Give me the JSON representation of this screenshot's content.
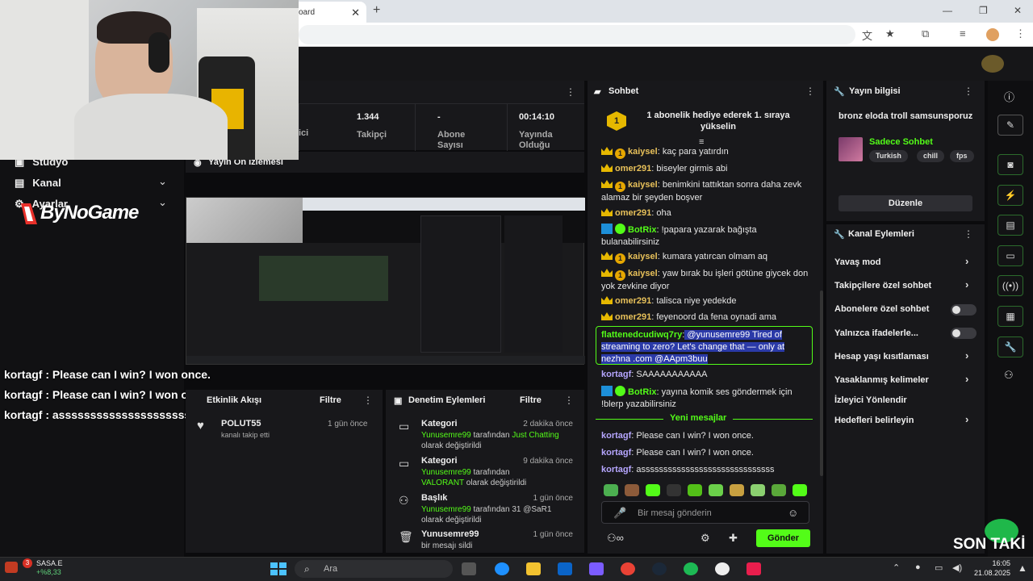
{
  "browser": {
    "tab_label": "oard",
    "tab_close": "✕",
    "new_tab": "+"
  },
  "stats": [
    {
      "value": "",
      "label": "ici"
    },
    {
      "value": "1.344",
      "label": "Takipçi"
    },
    {
      "value": "-",
      "label": "Abone Sayısı"
    },
    {
      "value": "00:14:10",
      "label": "Yayında Olduğu"
    }
  ],
  "left_nav": {
    "items": [
      {
        "label": "Stüdyo"
      },
      {
        "label": "Kanal"
      },
      {
        "label": "Ayarlar"
      }
    ],
    "logo_text": "ByNoGame"
  },
  "preview": {
    "title": "Yayın Ön İzlemesi"
  },
  "overlay_chat": [
    {
      "user": "kortagf",
      "text": ": Please can I win? I won once."
    },
    {
      "user": "kortagf",
      "text": ": Please can I win? I won once."
    },
    {
      "user": "kortagf",
      "text": ": assssssssssssssssssssssssssssss"
    }
  ],
  "activity": {
    "title": "Etkinlik Akışı",
    "filter": "Filtre",
    "events": [
      {
        "user": "POLUT55",
        "desc": "kanalı takip etti",
        "time": "1 gün önce"
      }
    ]
  },
  "modlog": {
    "title": "Denetim Eylemleri",
    "filter": "Filtre",
    "entries": [
      {
        "title": "Kategori",
        "time": "2 dakika önce",
        "actor": "Yunusemre99",
        "mid": " tarafından ",
        "target": "Just Chatting",
        "tail": " olarak değiştirildi"
      },
      {
        "title": "Kategori",
        "time": "9 dakika önce",
        "actor": "Yunusemre99",
        "mid": " tarafından",
        "target": "VALORANT",
        "tail": " olarak değiştirildi"
      },
      {
        "title": "Başlık",
        "time": "1 gün önce",
        "actor": "Yunusemre99",
        "mid": " tarafından ",
        "target": "31 @SaR1",
        "tail": " olarak değiştirildi"
      },
      {
        "title": "Yunusemre99",
        "time": "1 gün önce",
        "desc": "bir mesajı sildi"
      }
    ]
  },
  "chat": {
    "title": "Sohbet",
    "pinned": "1 abonelik hediye ederek 1. sıraya yükselin",
    "pinned_count": "1",
    "messages": [
      {
        "user": "kaiysel",
        "text": " kaç para yatırdın"
      },
      {
        "user": "omer291",
        "text": " biseyler girmis abi"
      },
      {
        "user": "kaiysel",
        "text": " benimkini tattıktan sonra daha zevk alamaz bir şeyden boşver"
      },
      {
        "user": "omer291",
        "text": " oha"
      },
      {
        "user": "BotRix",
        "text": " !papara yazarak bağışta bulanabilirsiniz"
      },
      {
        "user": "kaiysel",
        "text": " kumara yatırcan olmam aq"
      },
      {
        "user": "kaiysel",
        "text": " yaw bırak bu işleri götüne giycek don yok zevkine diyor"
      },
      {
        "user": "omer291",
        "text": " talisca niye yedekde"
      },
      {
        "user": "omer291",
        "text": " feyenoord da fena oynadi ama"
      },
      {
        "user": "flattenedcudiwq7ry",
        "text": " @yunusemre99 Tired of streaming to zero? Let's change that — only at nezhna .com @AApm3buu"
      },
      {
        "user": "kortagf",
        "text": " SAAAAAAAAAAA"
      },
      {
        "user": "BotRix",
        "text": " yayına komik ses göndermek için !blerp yazabilirsiniz"
      }
    ],
    "new_messages": "Yeni mesajlar",
    "new": [
      {
        "user": "kortagf",
        "text": " Please can I win? I won once."
      },
      {
        "user": "kortagf",
        "text": " Please can I win? I won once."
      },
      {
        "user": "kortagf",
        "text": " assssssssssssssssssssssssssssss"
      }
    ],
    "input_placeholder": "Bir mesaj gönderin",
    "send": "Gönder"
  },
  "stream_info": {
    "title": "Yayın bilgisi",
    "stream_title": "bronz eloda troll samsunsporuz",
    "category": "Sadece Sohbet",
    "tags": [
      "Turkish",
      "chill",
      "fps"
    ],
    "edit": "Düzenle"
  },
  "channel_actions": {
    "title": "Kanal Eylemleri",
    "items": [
      {
        "label": "Yavaş mod",
        "control": "chevron"
      },
      {
        "label": "Takipçilere özel sohbet",
        "control": "chevron"
      },
      {
        "label": "Abonelere özel sohbet",
        "control": "toggle"
      },
      {
        "label": "Yalnızca ifadelerle...",
        "control": "toggle"
      },
      {
        "label": "Hesap yaşı kısıtlaması",
        "control": "chevron"
      },
      {
        "label": "Yasaklanmış kelimeler",
        "control": "chevron"
      },
      {
        "label": "İzleyici Yönlendir",
        "control": "none"
      },
      {
        "label": "Hedefleri belirleyin",
        "control": "chevron"
      }
    ]
  },
  "son_takip": "SON TAKİ",
  "taskbar": {
    "stock_name": "SASA.E",
    "stock_change": "+%8,33",
    "stock_badge": "3",
    "search": "Ara",
    "time": "16:05",
    "date": "21.08.2025"
  },
  "colors": {
    "accent": "#53fc18",
    "panel": "#18181b",
    "bg": "#0b0b0d",
    "highlight": "#2b3aa8"
  }
}
